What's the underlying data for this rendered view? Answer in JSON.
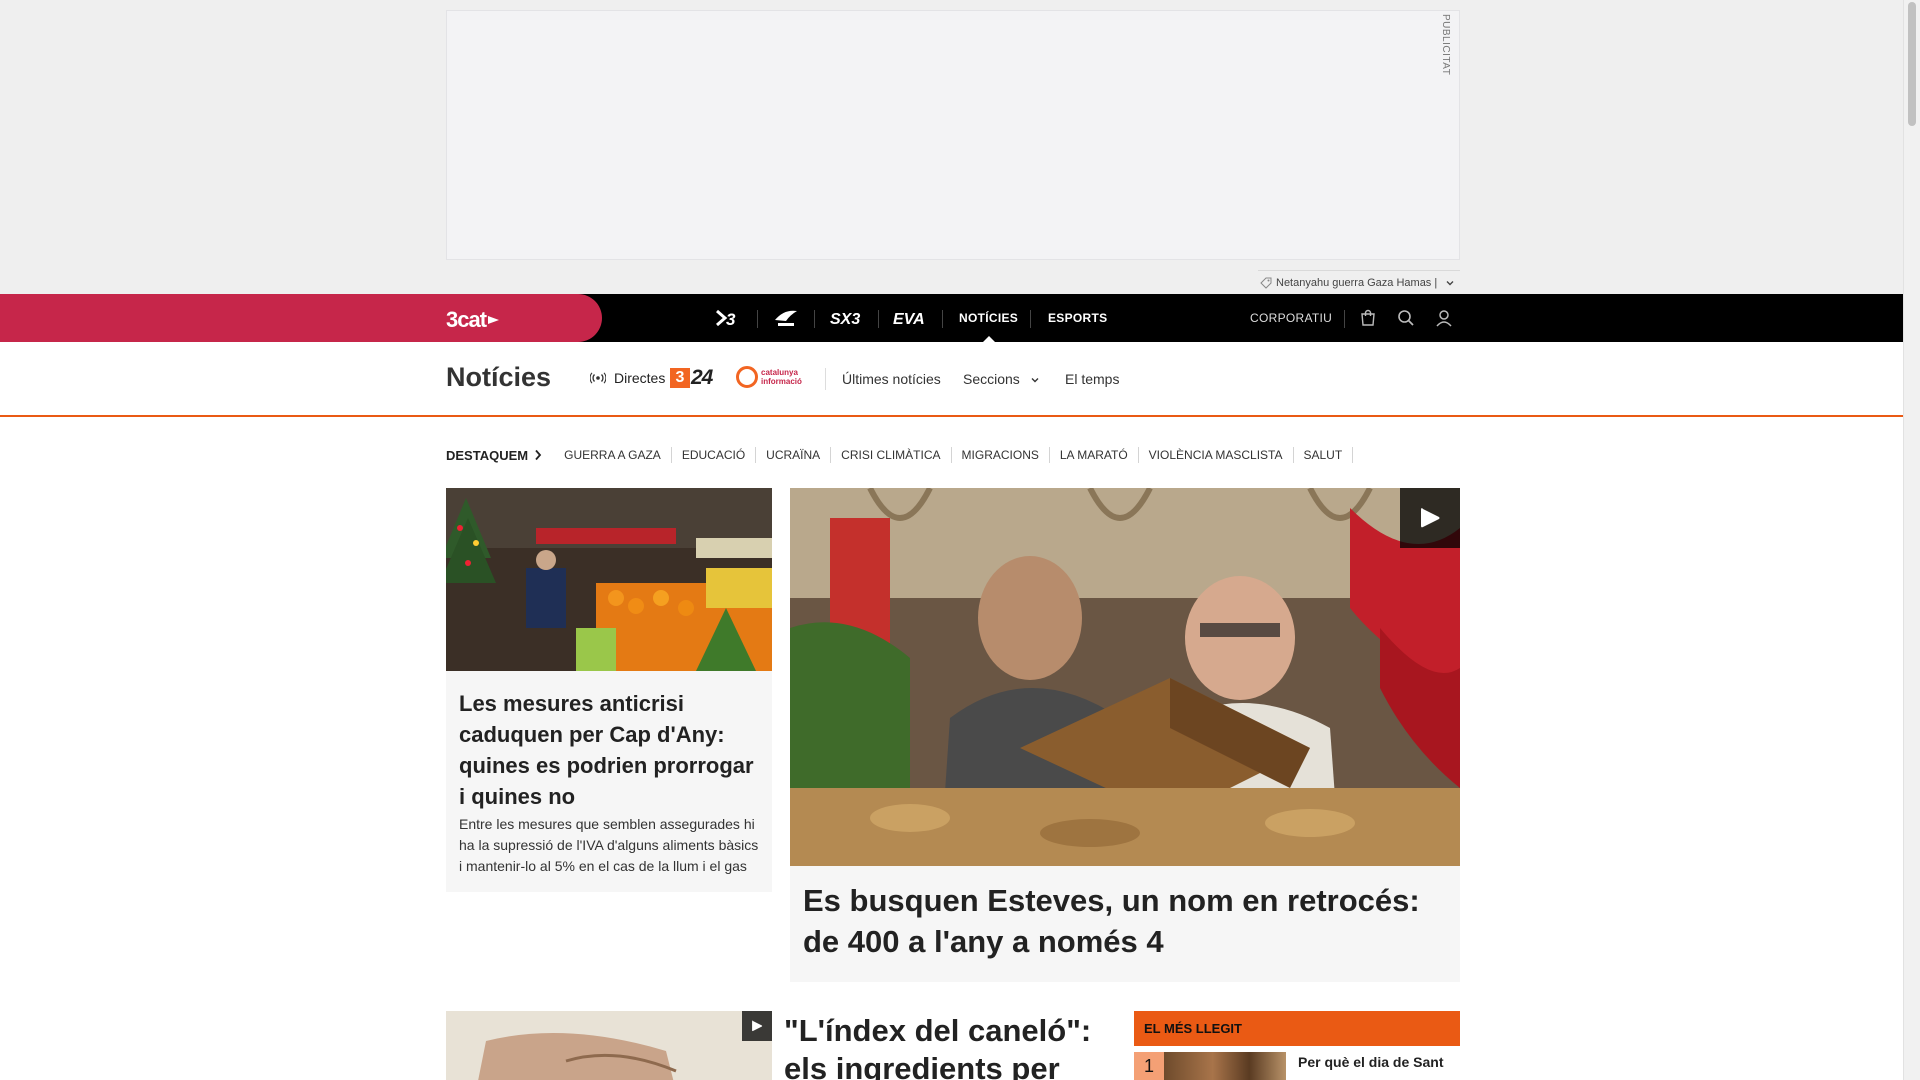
{
  "ad": {
    "label": "PUBLICITAT"
  },
  "trending": {
    "text": "Netanyahu guerra Gaza Hamas |"
  },
  "topnav": {
    "brand": "3cat",
    "channels": [
      {
        "name": "TV3",
        "icon": "tv3-logo-icon"
      },
      {
        "name": "Catalunya Ràdio",
        "icon": "catradio-logo-icon"
      },
      {
        "name": "SX3",
        "icon": "sx3-logo-icon"
      },
      {
        "name": "EVA",
        "icon": "eva-logo-icon"
      }
    ],
    "links": {
      "noticies": "NOTÍCIES",
      "esports": "ESPORTS",
      "corporatiu": "CORPORATIU"
    },
    "active": "NOTÍCIES"
  },
  "section": {
    "title": "Notícies",
    "directes": "Directes",
    "channel_324": "24",
    "channel_324_mark": "3",
    "ci_text": [
      "catalunya",
      "informació"
    ],
    "links": {
      "ultimes": "Últimes notícies",
      "seccions": "Seccions",
      "temps": "El temps"
    }
  },
  "tags": {
    "lead": "DESTAQUEM",
    "items": [
      "GUERRA A GAZA",
      "EDUCACIÓ",
      "UCRAÏNA",
      "CRISI CLIMÀTICA",
      "MIGRACIONS",
      "LA MARATÓ",
      "VIOLÈNCIA MASCLISTA",
      "SALUT"
    ]
  },
  "articles": {
    "a": {
      "title": "Les mesures anticrisi caduquen per Cap d'Any: quines es podrien prorrogar i quines no",
      "summary": "Entre les mesures que semblen assegurades hi ha la supressió de l'IVA d'alguns aliments bàsics i mantenir-lo al 5% en el cas de la llum i el gas"
    },
    "b": {
      "title": "Es busquen Esteves, un nom en retrocés: de 400 a l'any a només 4"
    },
    "d": {
      "title": "\"L'índex del caneló\": els ingredients per fer-ne"
    }
  },
  "most_read": {
    "header": "EL MÉS LLEGIT",
    "items": [
      {
        "rank": "1",
        "title": "Per què el dia de Sant"
      }
    ]
  },
  "colors": {
    "brand": "#c6264a",
    "accent": "#ea5a14",
    "nav_bg": "#000000"
  }
}
